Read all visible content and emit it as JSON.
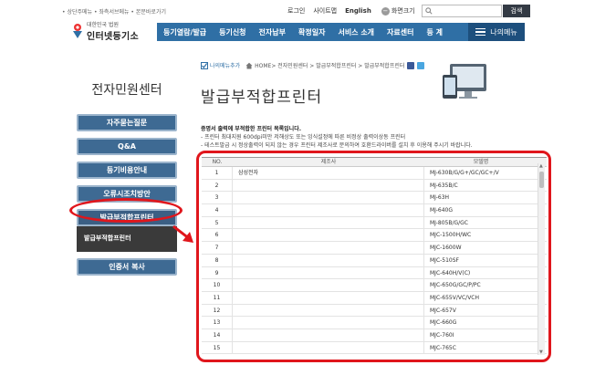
{
  "header": {
    "skip_links": "• 상단주메뉴 • 좌측서브메뉴 • 본문바로가기",
    "util": {
      "login": "로그인",
      "sitemap": "사이트맵",
      "english": "English",
      "zoom_minus": "−",
      "zoom_label": "화면크기",
      "zoom_plus": "+"
    },
    "search": {
      "placeholder": "",
      "button": "검색"
    },
    "logo": {
      "line1": "대한민국 법원",
      "line2": "인터넷등기소"
    },
    "gnb": [
      "등기열람/발급",
      "등기신청",
      "전자납부",
      "확정일자",
      "서비스 소개",
      "자료센터",
      "등 계"
    ],
    "my_menu": "나의메뉴"
  },
  "sidebar": {
    "title": "전자민원센터",
    "items": [
      {
        "label": "자주묻는질문"
      },
      {
        "label": "Q&A"
      },
      {
        "label": "등기비용안내"
      },
      {
        "label": "오류시조치방안"
      },
      {
        "label": "발급부적합프린터"
      },
      {
        "label": "인증서 복사"
      }
    ],
    "sub_active": "발급부적합프린터"
  },
  "breadcrumb": {
    "add_mymenu": "나의메뉴추가",
    "path": "HOME> 전자민원센터 > 발급부적합프린터 > 발급부적합프린터"
  },
  "page_title": "발급부적합프린터",
  "intro": {
    "heading": "증명서 출력에 부적합한 프린터 목록입니다.",
    "line1": "- 프린터 최대지원 600dpi미만 저해상도 또는 잉식설정에 따른 비정상 출력이상동 프린터",
    "line2": "- 테스트발급 시 정상출력이 되지 않는 경우 프린터 제조사로 문의하여 호환드라이버를 설치 후 이용해 주시기 바랍니다."
  },
  "table": {
    "headers": [
      "NO.",
      "제조사",
      "모델명"
    ],
    "rows": [
      [
        "1",
        "삼성전자",
        "MJ-630B/G/G+/GC/GC+/V"
      ],
      [
        "2",
        "",
        "MJ-635B/C"
      ],
      [
        "3",
        "",
        "MJ-63H"
      ],
      [
        "4",
        "",
        "MJ-640G"
      ],
      [
        "5",
        "",
        "MJ-805B/G/GC"
      ],
      [
        "6",
        "",
        "MJC-1500H/WC"
      ],
      [
        "7",
        "",
        "MJC-1600W"
      ],
      [
        "8",
        "",
        "MJC-510SF"
      ],
      [
        "9",
        "",
        "MJC-640H/V(C)"
      ],
      [
        "10",
        "",
        "MJC-650G/GC/P/PC"
      ],
      [
        "11",
        "",
        "MJC-655V/VC/VCH"
      ],
      [
        "12",
        "",
        "MJC-657V"
      ],
      [
        "13",
        "",
        "MJC-660G"
      ],
      [
        "14",
        "",
        "MJC-760I"
      ],
      [
        "15",
        "",
        "MJC-765C"
      ]
    ]
  },
  "colors": {
    "nav_blue": "#2f6fa5",
    "highlight_red": "#e0161c",
    "side_button": "#3e6a93"
  }
}
